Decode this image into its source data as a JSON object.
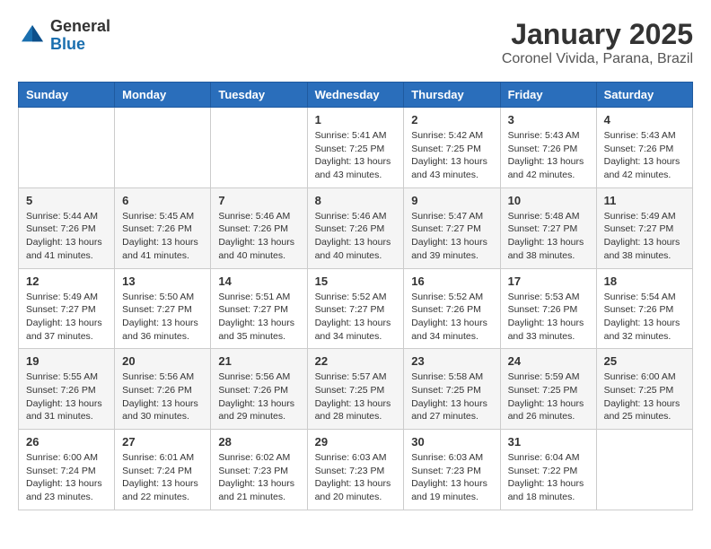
{
  "header": {
    "logo_general": "General",
    "logo_blue": "Blue",
    "title": "January 2025",
    "subtitle": "Coronel Vivida, Parana, Brazil"
  },
  "days_of_week": [
    "Sunday",
    "Monday",
    "Tuesday",
    "Wednesday",
    "Thursday",
    "Friday",
    "Saturday"
  ],
  "weeks": [
    [
      {
        "day": "",
        "info": ""
      },
      {
        "day": "",
        "info": ""
      },
      {
        "day": "",
        "info": ""
      },
      {
        "day": "1",
        "info": "Sunrise: 5:41 AM\nSunset: 7:25 PM\nDaylight: 13 hours\nand 43 minutes."
      },
      {
        "day": "2",
        "info": "Sunrise: 5:42 AM\nSunset: 7:25 PM\nDaylight: 13 hours\nand 43 minutes."
      },
      {
        "day": "3",
        "info": "Sunrise: 5:43 AM\nSunset: 7:26 PM\nDaylight: 13 hours\nand 42 minutes."
      },
      {
        "day": "4",
        "info": "Sunrise: 5:43 AM\nSunset: 7:26 PM\nDaylight: 13 hours\nand 42 minutes."
      }
    ],
    [
      {
        "day": "5",
        "info": "Sunrise: 5:44 AM\nSunset: 7:26 PM\nDaylight: 13 hours\nand 41 minutes."
      },
      {
        "day": "6",
        "info": "Sunrise: 5:45 AM\nSunset: 7:26 PM\nDaylight: 13 hours\nand 41 minutes."
      },
      {
        "day": "7",
        "info": "Sunrise: 5:46 AM\nSunset: 7:26 PM\nDaylight: 13 hours\nand 40 minutes."
      },
      {
        "day": "8",
        "info": "Sunrise: 5:46 AM\nSunset: 7:26 PM\nDaylight: 13 hours\nand 40 minutes."
      },
      {
        "day": "9",
        "info": "Sunrise: 5:47 AM\nSunset: 7:27 PM\nDaylight: 13 hours\nand 39 minutes."
      },
      {
        "day": "10",
        "info": "Sunrise: 5:48 AM\nSunset: 7:27 PM\nDaylight: 13 hours\nand 38 minutes."
      },
      {
        "day": "11",
        "info": "Sunrise: 5:49 AM\nSunset: 7:27 PM\nDaylight: 13 hours\nand 38 minutes."
      }
    ],
    [
      {
        "day": "12",
        "info": "Sunrise: 5:49 AM\nSunset: 7:27 PM\nDaylight: 13 hours\nand 37 minutes."
      },
      {
        "day": "13",
        "info": "Sunrise: 5:50 AM\nSunset: 7:27 PM\nDaylight: 13 hours\nand 36 minutes."
      },
      {
        "day": "14",
        "info": "Sunrise: 5:51 AM\nSunset: 7:27 PM\nDaylight: 13 hours\nand 35 minutes."
      },
      {
        "day": "15",
        "info": "Sunrise: 5:52 AM\nSunset: 7:27 PM\nDaylight: 13 hours\nand 34 minutes."
      },
      {
        "day": "16",
        "info": "Sunrise: 5:52 AM\nSunset: 7:26 PM\nDaylight: 13 hours\nand 34 minutes."
      },
      {
        "day": "17",
        "info": "Sunrise: 5:53 AM\nSunset: 7:26 PM\nDaylight: 13 hours\nand 33 minutes."
      },
      {
        "day": "18",
        "info": "Sunrise: 5:54 AM\nSunset: 7:26 PM\nDaylight: 13 hours\nand 32 minutes."
      }
    ],
    [
      {
        "day": "19",
        "info": "Sunrise: 5:55 AM\nSunset: 7:26 PM\nDaylight: 13 hours\nand 31 minutes."
      },
      {
        "day": "20",
        "info": "Sunrise: 5:56 AM\nSunset: 7:26 PM\nDaylight: 13 hours\nand 30 minutes."
      },
      {
        "day": "21",
        "info": "Sunrise: 5:56 AM\nSunset: 7:26 PM\nDaylight: 13 hours\nand 29 minutes."
      },
      {
        "day": "22",
        "info": "Sunrise: 5:57 AM\nSunset: 7:25 PM\nDaylight: 13 hours\nand 28 minutes."
      },
      {
        "day": "23",
        "info": "Sunrise: 5:58 AM\nSunset: 7:25 PM\nDaylight: 13 hours\nand 27 minutes."
      },
      {
        "day": "24",
        "info": "Sunrise: 5:59 AM\nSunset: 7:25 PM\nDaylight: 13 hours\nand 26 minutes."
      },
      {
        "day": "25",
        "info": "Sunrise: 6:00 AM\nSunset: 7:25 PM\nDaylight: 13 hours\nand 25 minutes."
      }
    ],
    [
      {
        "day": "26",
        "info": "Sunrise: 6:00 AM\nSunset: 7:24 PM\nDaylight: 13 hours\nand 23 minutes."
      },
      {
        "day": "27",
        "info": "Sunrise: 6:01 AM\nSunset: 7:24 PM\nDaylight: 13 hours\nand 22 minutes."
      },
      {
        "day": "28",
        "info": "Sunrise: 6:02 AM\nSunset: 7:23 PM\nDaylight: 13 hours\nand 21 minutes."
      },
      {
        "day": "29",
        "info": "Sunrise: 6:03 AM\nSunset: 7:23 PM\nDaylight: 13 hours\nand 20 minutes."
      },
      {
        "day": "30",
        "info": "Sunrise: 6:03 AM\nSunset: 7:23 PM\nDaylight: 13 hours\nand 19 minutes."
      },
      {
        "day": "31",
        "info": "Sunrise: 6:04 AM\nSunset: 7:22 PM\nDaylight: 13 hours\nand 18 minutes."
      },
      {
        "day": "",
        "info": ""
      }
    ]
  ]
}
